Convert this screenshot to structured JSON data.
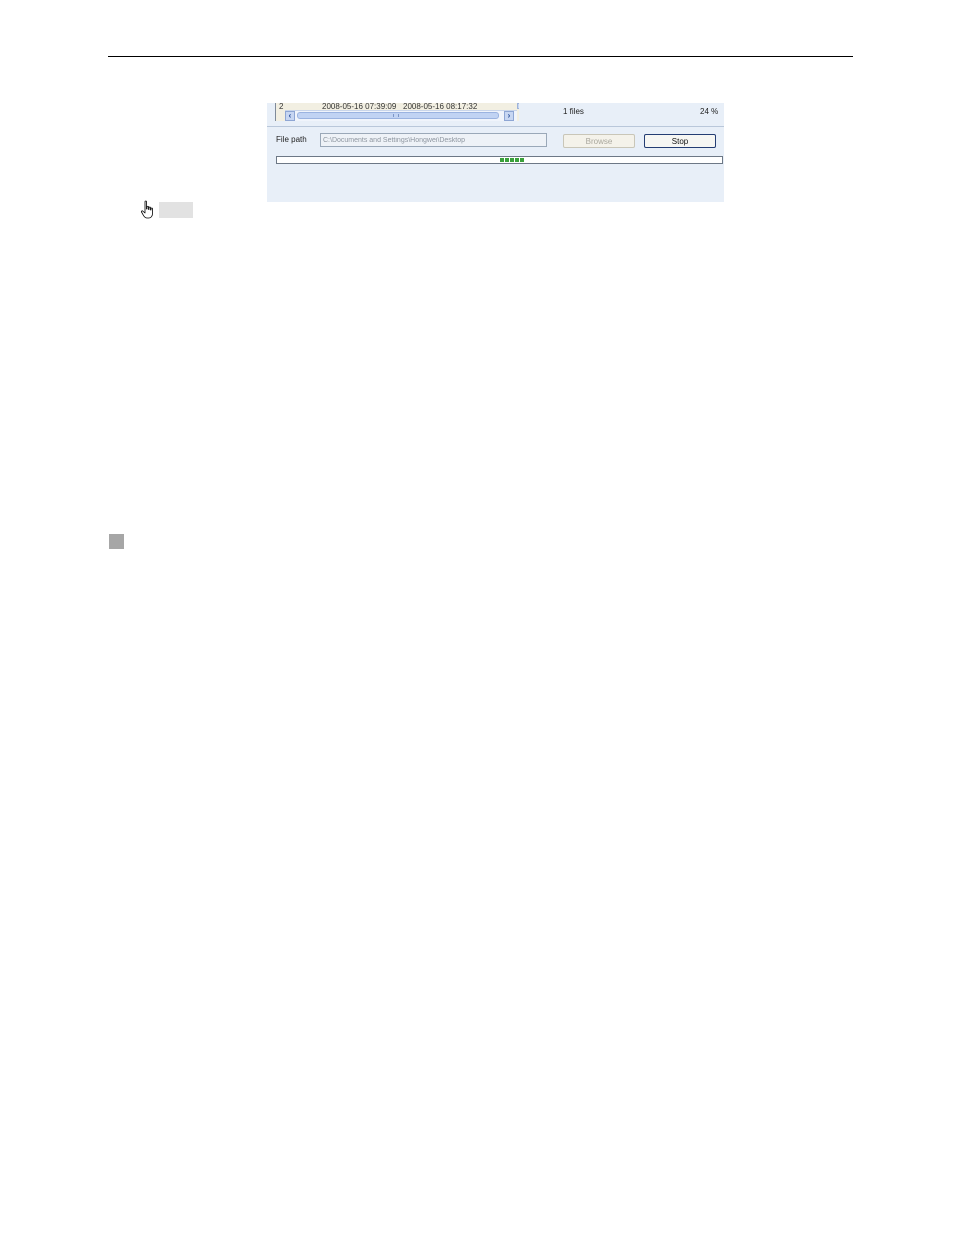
{
  "record_list": {
    "row": {
      "index": "2",
      "start_time": "2008-05-16 07:39:09",
      "end_time": "2008-05-16 08:17:32"
    }
  },
  "status": {
    "files_count": "1 files",
    "percent": "24 %"
  },
  "file_path": {
    "label": "File path",
    "value": "C:\\Documents and Settings\\Hongwei\\Desktop"
  },
  "buttons": {
    "browse_label": "Browse",
    "stop_label": "Stop"
  },
  "progress": {
    "indicator_blocks": 5,
    "color": "#3aa13a"
  },
  "icons": {
    "cursor": "hand-pointer-icon",
    "scroll_left": "chevron-left-icon",
    "scroll_right": "chevron-right-icon",
    "scroll_down": "chevron-down-icon"
  }
}
